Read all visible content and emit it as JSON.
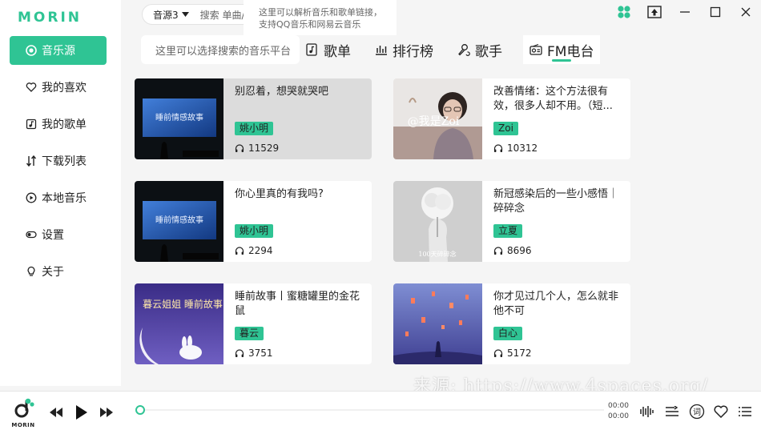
{
  "app": {
    "logo": "MORIN",
    "player_logo": "MORIN"
  },
  "colors": {
    "accent": "#2fc494",
    "tag": "#2fc494"
  },
  "sidebar": {
    "items": [
      {
        "label": "音乐源",
        "icon": "radio-circle-icon",
        "active": true
      },
      {
        "label": "我的喜欢",
        "icon": "heart-icon"
      },
      {
        "label": "我的歌单",
        "icon": "playlist-icon"
      },
      {
        "label": "下载列表",
        "icon": "download-list-icon"
      },
      {
        "label": "本地音乐",
        "icon": "local-music-icon"
      },
      {
        "label": "设置",
        "icon": "toggle-icon"
      },
      {
        "label": "关于",
        "icon": "lightbulb-icon"
      }
    ]
  },
  "search": {
    "source": "音源3",
    "placeholder": "搜索 单曲/歌手"
  },
  "tooltip": {
    "line1": "这里可以解析音乐和歌单链接，",
    "line2": "支持QQ音乐和网易云音乐"
  },
  "platform_input": {
    "placeholder": "这里可以选择搜索的音乐平台"
  },
  "tabs": [
    {
      "label": "歌单",
      "icon": "playlist-icon"
    },
    {
      "label": "排行榜",
      "icon": "bar-chart-icon"
    },
    {
      "label": "歌手",
      "icon": "singer-icon"
    },
    {
      "label": "FM电台",
      "icon": "radio-icon",
      "active": true
    }
  ],
  "cards": [
    {
      "title": "别忍着，想哭就哭吧",
      "author": "姚小明",
      "plays": "11529",
      "cover_text": "睡前情感故事"
    },
    {
      "title": "改善情绪：这个方法很有效，很多人却不用。（短...",
      "author": "Zoi",
      "plays": "10312",
      "cover_text": "@我是Zoi"
    },
    {
      "title": "你心里真的有我吗?",
      "author": "姚小明",
      "plays": "2294",
      "cover_text": "睡前情感故事"
    },
    {
      "title": "新冠感染后的一些小感悟｜碎碎念",
      "author": "立夏",
      "plays": "8696",
      "cover_text": "100天碎碎念"
    },
    {
      "title": "睡前故事丨蜜糖罐里的金花鼠",
      "author": "暮云",
      "plays": "3751",
      "cover_text": "暮云姐姐 睡前故事"
    },
    {
      "title": "你才见过几个人，怎么就非他不可",
      "author": "白心",
      "plays": "5172",
      "cover_text": ""
    }
  ],
  "player": {
    "time_current": "00:00",
    "time_total": "00:00",
    "lyrics_label": "词",
    "progress": 0
  },
  "watermark": "来源: https://www.4spaces.org/"
}
